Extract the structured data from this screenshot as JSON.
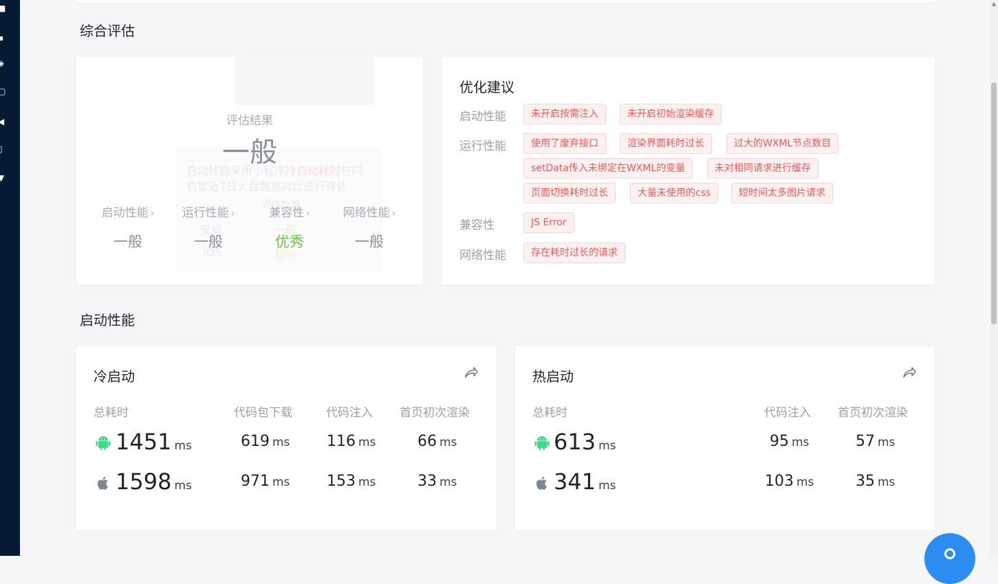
{
  "sections": {
    "overall": "综合评估",
    "startup": "启动性能"
  },
  "evaluation": {
    "label": "评估结果",
    "result": "一般",
    "metrics": [
      {
        "name": "启动性能",
        "value": "一般",
        "status": "normal"
      },
      {
        "name": "运行性能",
        "value": "一般",
        "status": "normal"
      },
      {
        "name": "兼容性",
        "value": "优秀",
        "status": "good"
      },
      {
        "name": "网络性能",
        "value": "一般",
        "status": "normal"
      }
    ],
    "tooltip_ghost": {
      "line1": "启动性能采用小程序",
      "highlight": "冷启动耗时",
      "line1_tail": "与同",
      "line2": "机型近7日大盘数据对比进行评估",
      "rows": [
        {
          "platform": "安卓",
          "level": "一般"
        },
        {
          "platform": "iOS",
          "level": "较差"
        }
      ],
      "header": "评估标准"
    }
  },
  "suggestions": {
    "title": "优化建议",
    "groups": [
      {
        "label": "启动性能",
        "tags": [
          "未开启按需注入",
          "未开启初始渲染缓存"
        ]
      },
      {
        "label": "运行性能",
        "tags": [
          "使用了废弃接口",
          "渲染界面耗时过长",
          "过大的WXML节点数目",
          "setData传入未绑定在WXML的变量",
          "未对相同请求进行缓存",
          "页面切换耗时过长",
          "大量未使用的css",
          "短时间太多图片请求"
        ]
      },
      {
        "label": "兼容性",
        "tags": [
          "JS Error"
        ]
      },
      {
        "label": "网络性能",
        "tags": [
          "存在耗时过长的请求"
        ]
      }
    ]
  },
  "cold_start": {
    "title": "冷启动",
    "columns": [
      "总耗时",
      "代码包下载",
      "代码注入",
      "首页初次渲染"
    ],
    "unit": "ms",
    "android": {
      "total": "1451",
      "download": "619",
      "inject": "116",
      "render": "66"
    },
    "ios": {
      "total": "1598",
      "download": "971",
      "inject": "153",
      "render": "33"
    }
  },
  "hot_start": {
    "title": "热启动",
    "columns": [
      "总耗时",
      "代码注入",
      "首页初次渲染"
    ],
    "unit": "ms",
    "android": {
      "total": "613",
      "inject": "95",
      "render": "57"
    },
    "ios": {
      "total": "341",
      "inject": "103",
      "render": "35"
    }
  },
  "icons": {
    "share": "share-icon",
    "android": "android-icon",
    "apple": "apple-icon",
    "fab": "help-icon"
  },
  "colors": {
    "sidebar": "#061a33",
    "good": "#6cc24a",
    "tag_text": "#f25a5a",
    "tag_bg": "#fdf0f0",
    "android": "#3ddc84",
    "fab": "#2d8cf0"
  }
}
